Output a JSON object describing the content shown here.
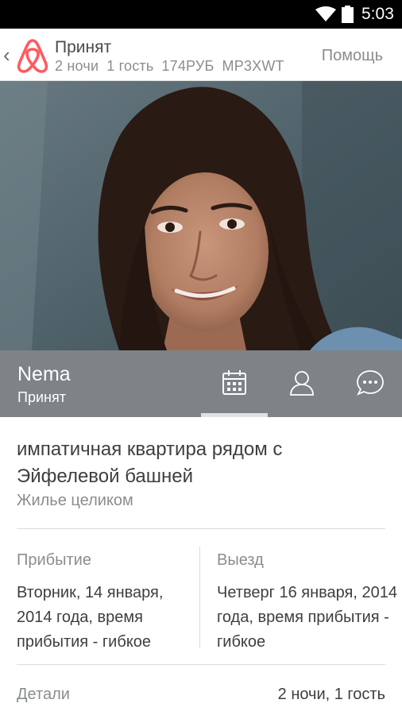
{
  "status_bar": {
    "time": "5:03"
  },
  "header": {
    "title": "Принят",
    "nights": "2 ночи",
    "guests": "1 гость",
    "price": "174РУБ",
    "code": "MP3XWT",
    "help_label": "Помощь"
  },
  "guest": {
    "name": "Nema",
    "status": "Принят"
  },
  "tabs": [
    {
      "icon": "calendar-icon",
      "active": true
    },
    {
      "icon": "person-icon",
      "active": false
    },
    {
      "icon": "chat-bubble-icon",
      "active": false
    }
  ],
  "listing": {
    "title": "импатичная квартира рядом с Эйфелевой башней",
    "type": "Жилье целиком"
  },
  "checkin": {
    "label": "Прибытие",
    "value": "Вторник, 14 января, 2014 года, время прибытия - гибкое"
  },
  "checkout": {
    "label": "Выезд",
    "value": "Четверг 16 января, 2014 года, время прибытия - гибкое"
  },
  "details": {
    "label": "Детали",
    "value": "2 ночи, 1 гость"
  },
  "colors": {
    "brand": "#ff5a5f",
    "guest_bar": "#7d8386",
    "status_bar": "#000000",
    "muted_text": "#8a8d8e"
  }
}
